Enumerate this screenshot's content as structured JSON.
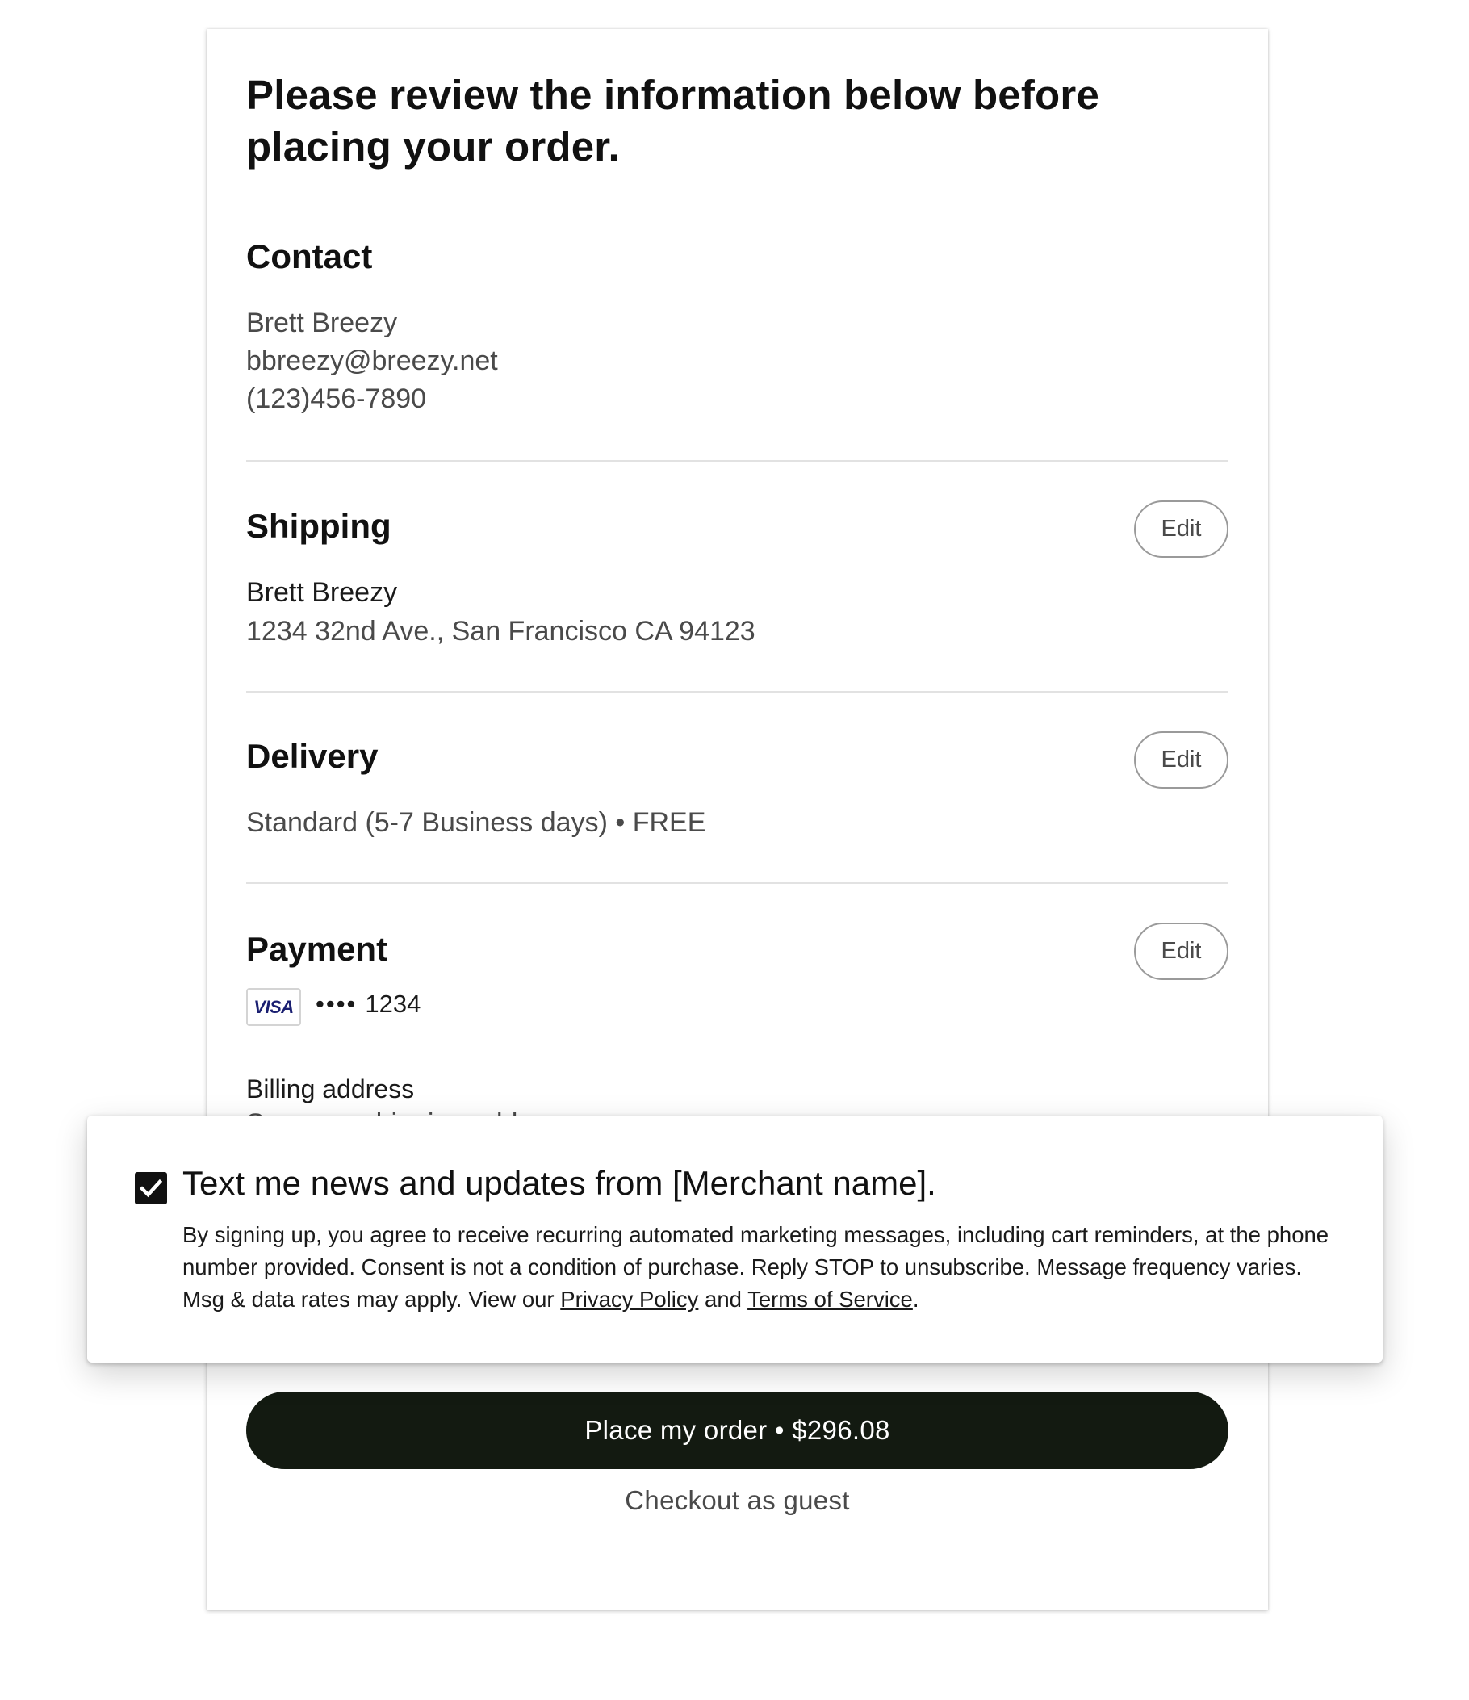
{
  "review": {
    "title": "Please review the information below before placing your order."
  },
  "contact": {
    "heading": "Contact",
    "name": "Brett Breezy",
    "email": "bbreezy@breezy.net",
    "phone": "(123)456-7890"
  },
  "shipping": {
    "heading": "Shipping",
    "edit_label": "Edit",
    "name": "Brett Breezy",
    "address": "1234 32nd Ave., San Francisco CA 94123"
  },
  "delivery": {
    "heading": "Delivery",
    "edit_label": "Edit",
    "method": "Standard (5-7 Business days) • FREE"
  },
  "payment": {
    "heading": "Payment",
    "edit_label": "Edit",
    "card_brand": "VISA",
    "card_dots": "••••",
    "card_last4": "1234",
    "billing_heading": "Billing address",
    "billing_value": "Same as shipping address"
  },
  "sms_optin": {
    "checked": true,
    "label": "Text me news and updates from [Merchant name].",
    "legal_text": "By signing up, you agree to receive recurring automated marketing messages, including cart reminders, at the phone number provided. Consent is not a condition of purchase. Reply STOP to unsubscribe. Message frequency varies. Msg & data rates may apply. View our",
    "privacy_link": "Privacy Policy",
    "and_text": "and",
    "terms_link": "Terms of Service",
    "end_punct": "."
  },
  "actions": {
    "place_order_label": "Place my order • $296.08",
    "guest_label": "Checkout as guest"
  },
  "colors": {
    "primary_button": "#131a11",
    "visa_blue": "#1a1f71"
  },
  "icons": {
    "checkbox": "check-icon",
    "card": "visa-icon"
  }
}
